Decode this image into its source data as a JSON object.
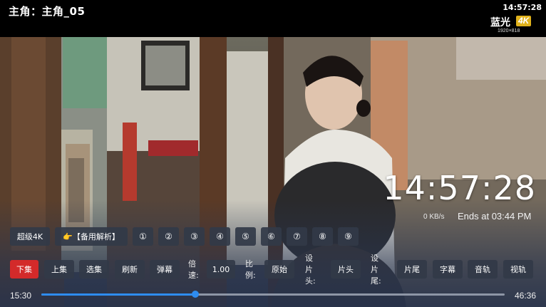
{
  "header": {
    "title": "主角：主角_05",
    "clock": "14:57:28",
    "quality_badge": {
      "label": "蓝光",
      "tag": "4K",
      "resolution": "1920×818"
    }
  },
  "overlay": {
    "clock": "14:57:28",
    "speed": "0 KB/s",
    "ends_at": "Ends at 03:44 PM"
  },
  "sources": {
    "quality": "超级4K",
    "backup": "👉【备用解析】",
    "circled": [
      "①",
      "②",
      "③",
      "④",
      "⑤",
      "⑥",
      "⑦",
      "⑧",
      "⑨"
    ]
  },
  "controls": {
    "next": "下集",
    "prev": "上集",
    "episodes": "选集",
    "refresh": "刷新",
    "danmaku": "弹幕",
    "speed_label": "倍速:",
    "speed_value": "1.00",
    "ratio_label": "比例:",
    "ratio_value": "原始",
    "opening_label": "设片头:",
    "opening_value": "片头",
    "ending_label": "设片尾:",
    "ending_value": "片尾",
    "subtitle": "字幕",
    "audio": "音轨",
    "video_track": "视轨"
  },
  "progress": {
    "current": "15:30",
    "total": "46:36",
    "fraction": 0.333
  },
  "colors": {
    "accent": "#2e8cf0",
    "active_button": "#d32a2a",
    "badge": "#e0b21c"
  }
}
